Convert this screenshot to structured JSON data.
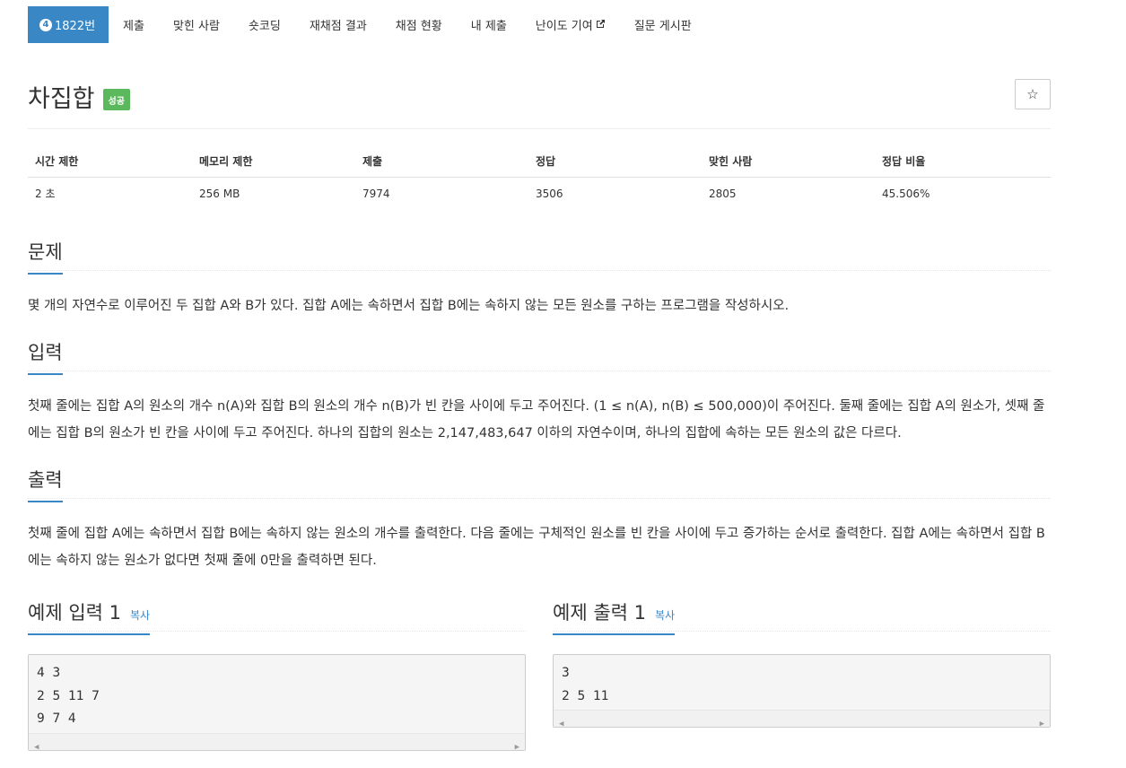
{
  "tabs": {
    "problem_number": "1822번",
    "tier": "4",
    "items": [
      "제출",
      "맞힌 사람",
      "숏코딩",
      "재채점 결과",
      "채점 현황",
      "내 제출",
      "난이도 기여",
      "질문 게시판"
    ]
  },
  "problem": {
    "title": "차집합",
    "badge": "성공",
    "star": "☆"
  },
  "info": {
    "headers": [
      "시간 제한",
      "메모리 제한",
      "제출",
      "정답",
      "맞힌 사람",
      "정답 비율"
    ],
    "values": [
      "2 초",
      "256 MB",
      "7974",
      "3506",
      "2805",
      "45.506%"
    ]
  },
  "sections": {
    "problem_title": "문제",
    "problem_text": "몇 개의 자연수로 이루어진 두 집합 A와 B가 있다. 집합 A에는 속하면서 집합 B에는 속하지 않는 모든 원소를 구하는 프로그램을 작성하시오.",
    "input_title": "입력",
    "input_text": "첫째 줄에는 집합 A의 원소의 개수 n(A)와 집합 B의 원소의 개수 n(B)가 빈 칸을 사이에 두고 주어진다. (1 ≤ n(A), n(B) ≤ 500,000)이 주어진다. 둘째 줄에는 집합 A의 원소가, 셋째 줄에는 집합 B의 원소가 빈 칸을 사이에 두고 주어진다. 하나의 집합의 원소는 2,147,483,647 이하의 자연수이며, 하나의 집합에 속하는 모든 원소의 값은 다르다.",
    "output_title": "출력",
    "output_text": "첫째 줄에 집합 A에는 속하면서 집합 B에는 속하지 않는 원소의 개수를 출력한다. 다음 줄에는 구체적인 원소를 빈 칸을 사이에 두고 증가하는 순서로 출력한다. 집합 A에는 속하면서 집합 B에는 속하지 않는 원소가 없다면 첫째 줄에 0만을 출력하면 된다."
  },
  "samples": {
    "input_title": "예제 입력 1",
    "output_title": "예제 출력 1",
    "copy_label": "복사",
    "input_lines": [
      "4 3",
      "2 5 11 7",
      "9 7 4"
    ],
    "output_lines": [
      "3",
      "2 5 11"
    ]
  },
  "colors": {
    "accent": "#3a87c6",
    "success": "#5cb85c"
  }
}
